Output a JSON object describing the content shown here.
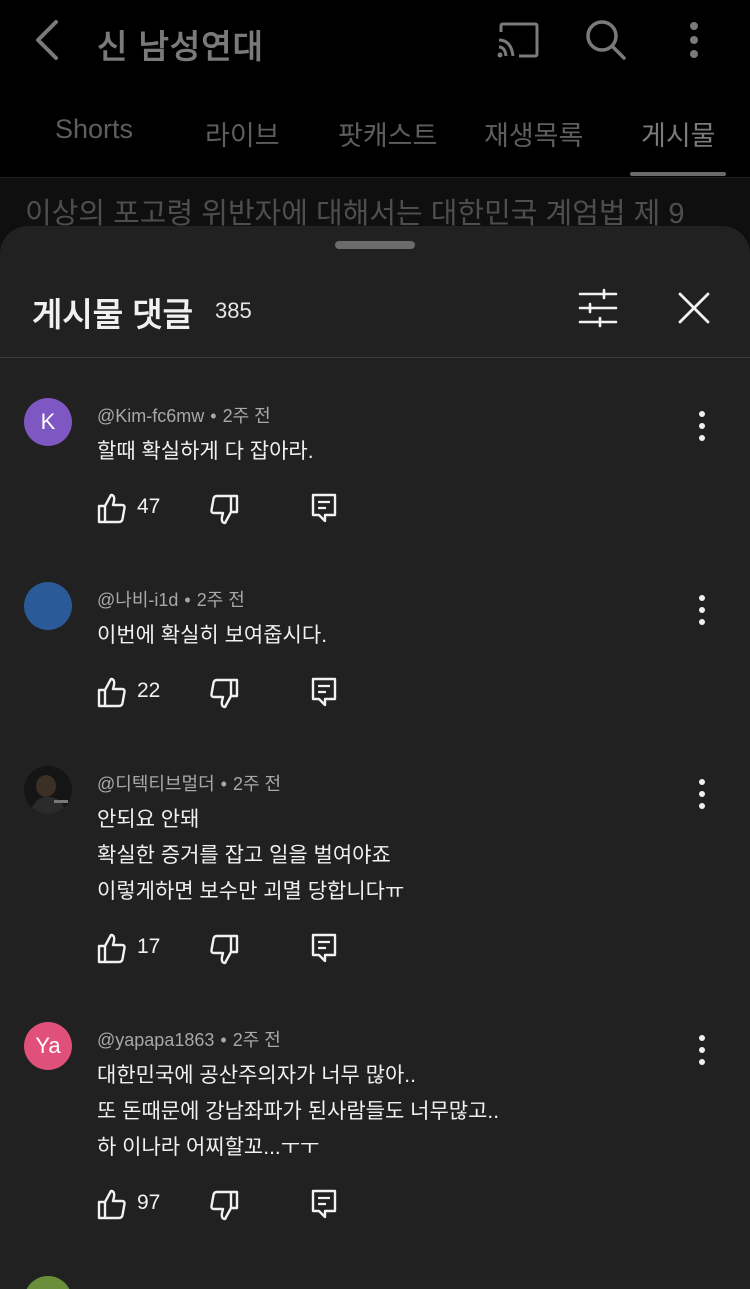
{
  "header": {
    "title": "신 남성연대",
    "back_icon": "back-arrow-icon",
    "cast_icon": "cast-icon",
    "search_icon": "search-icon",
    "more_icon": "more-vertical-icon"
  },
  "tabs": [
    {
      "label": "Shorts"
    },
    {
      "label": "라이브"
    },
    {
      "label": "팟캐스트"
    },
    {
      "label": "재생목록"
    },
    {
      "label": "게시물",
      "active": true
    }
  ],
  "background_post_text": "이상의 포고령 위반자에 대해서는 대한민국 계엄법 제 9",
  "sheet": {
    "title": "게시물 댓글",
    "count": "385",
    "filter_icon": "sort-filter-icon",
    "close_icon": "close-icon"
  },
  "comments": [
    {
      "avatar_letter": "K",
      "avatar_color": "#7e57c2",
      "author": "@Kim-fc6mw",
      "time": "2주 전",
      "lines": [
        "할때 확실하게 다 잡아라."
      ],
      "likes": "47"
    },
    {
      "avatar_letter": "",
      "avatar_color": "#2a5a98",
      "author": "@나비-i1d",
      "time": "2주 전",
      "lines": [
        "이번에 확실히 보여줍시다."
      ],
      "likes": "22"
    },
    {
      "avatar_letter": "",
      "avatar_color": "#1a1a1a",
      "author": "@디텍티브멀더",
      "time": "2주 전",
      "lines": [
        "안되요 안돼",
        "확실한 증거를 잡고 일을 벌여야죠",
        "이렇게하면 보수만 괴멸 당합니다ㅠ"
      ],
      "likes": "17"
    },
    {
      "avatar_letter": "Ya",
      "avatar_color": "#e0507a",
      "author": "@yapapa1863",
      "time": "2주 전",
      "lines": [
        "대한민국에 공산주의자가 너무 많아..",
        "또 돈때문에 강남좌파가 된사람들도 너무많고..",
        "하 이나라 어찌할꼬...ㅜㅜ"
      ],
      "likes": "97"
    }
  ],
  "partial_comment": {
    "avatar_color": "#6b8e3a"
  }
}
